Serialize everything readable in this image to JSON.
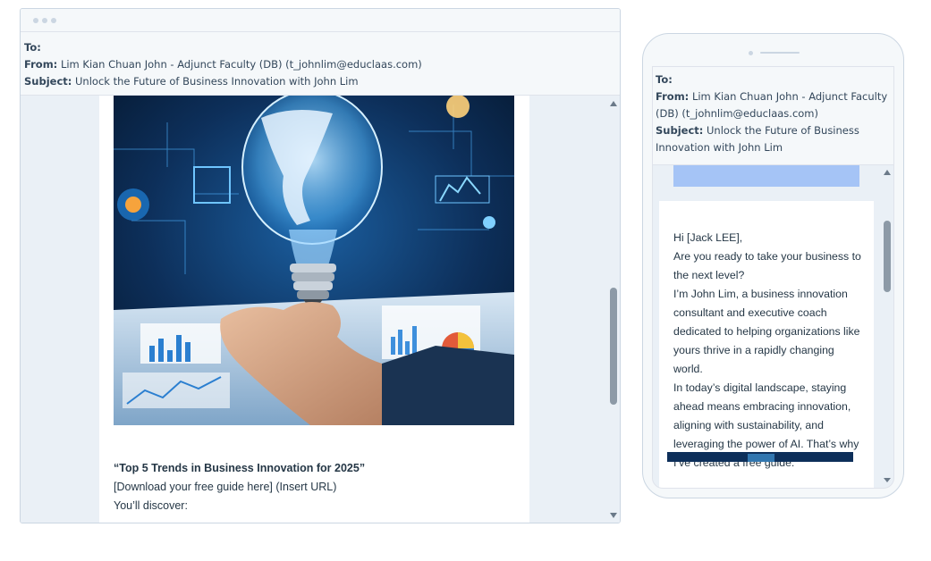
{
  "email": {
    "to_label": "To:",
    "from_label": "From:",
    "from_value": "Lim Kian Chuan John - Adjunct Faculty (DB) (t_johnlim@educlaas.com)",
    "subject_label": "Subject:",
    "subject_value": "Unlock the Future of Business Innovation with John Lim"
  },
  "desktop": {
    "hero_image_alt": "Lightbulb with globe over business charts",
    "guide_title": "“Top 5 Trends in Business Innovation for 2025”",
    "download_link": "[Download your free guide here] (Insert URL)",
    "discover_text": "You’ll discover:"
  },
  "mobile": {
    "greeting": "Hi [Jack LEE],",
    "paragraphs": [
      "Are you ready to take your business to the next level?",
      "I’m John Lim, a business innovation consultant and executive coach dedicated to helping organizations like yours thrive in a rapidly changing world.",
      "In today’s digital landscape, staying ahead means embracing innovation, aligning with sustainability, and leveraging the power of AI. That’s why I’ve created a free guide:"
    ]
  },
  "colors": {
    "background": "#eaf0f6",
    "border": "#cbd6e2",
    "banner_blue": "#a5c4f6",
    "text": "#33475b"
  },
  "icons": [
    "scroll-up-arrow-icon",
    "scroll-down-arrow-icon",
    "window-dots-icon"
  ]
}
